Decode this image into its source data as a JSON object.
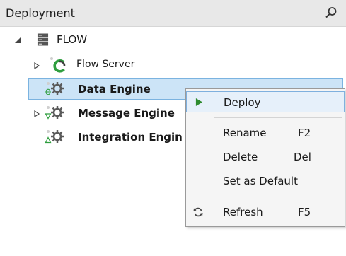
{
  "panel": {
    "title": "Deployment",
    "search_icon": "search-icon"
  },
  "tree": {
    "root": {
      "label": "FLOW",
      "icon": "server-stack-icon",
      "expanded": true
    },
    "items": [
      {
        "label": "Flow Server",
        "icon": "flow-server-icon",
        "bold": false,
        "expandable": true
      },
      {
        "label": "Data Engine",
        "icon": "data-engine-gear-icon",
        "bold": true,
        "expandable": false,
        "selected": true
      },
      {
        "label": "Message Engine",
        "icon": "message-engine-gear-icon",
        "bold": true,
        "expandable": true
      },
      {
        "label": "Integration Engin",
        "icon": "integration-engine-gear-icon",
        "bold": true,
        "expandable": false
      }
    ]
  },
  "context_menu": {
    "items": [
      {
        "label": "Deploy",
        "shortcut": "",
        "icon": "play-icon",
        "highlighted": true
      },
      {
        "label": "Rename",
        "shortcut": "F2",
        "icon": ""
      },
      {
        "label": "Delete",
        "shortcut": "Del",
        "icon": ""
      },
      {
        "label": "Set as Default",
        "shortcut": "",
        "icon": ""
      },
      {
        "label": "Refresh",
        "shortcut": "F5",
        "icon": "refresh-icon"
      }
    ]
  },
  "colors": {
    "header_bg": "#e8e8e8",
    "selection_bg": "#cce4f7",
    "selection_border": "#7bb3e0",
    "play_green": "#2e8b2e",
    "flow_green": "#2f9e3f",
    "gear_gray": "#5a5a5a"
  }
}
